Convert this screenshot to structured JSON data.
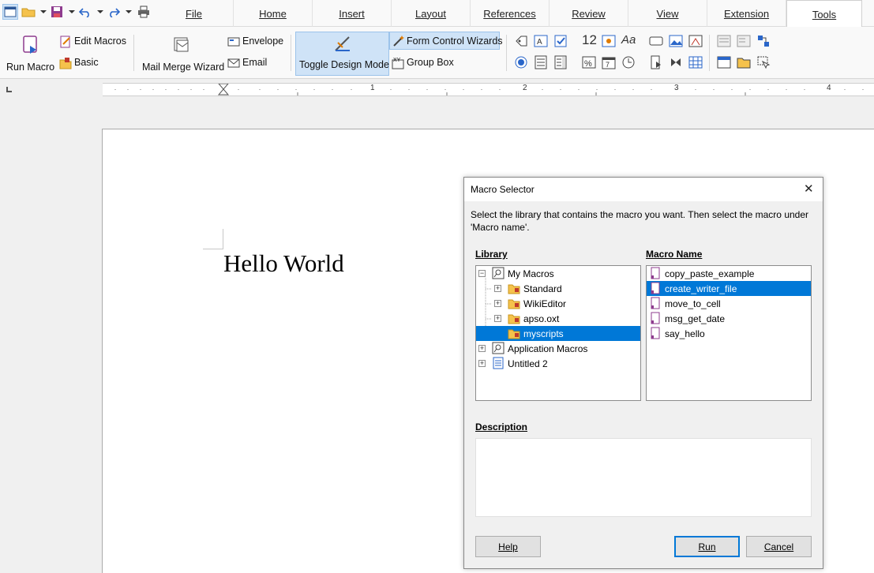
{
  "tabs": [
    "File",
    "Home",
    "Insert",
    "Layout",
    "References",
    "Review",
    "View",
    "Extension",
    "Tools"
  ],
  "active_tab": "Tools",
  "ribbon": {
    "run_macro": "Run Macro",
    "edit_macros": "Edit Macros",
    "basic": "Basic",
    "mail_merge": "Mail Merge Wizard",
    "envelope": "Envelope",
    "email": "Email",
    "toggle_design": "Toggle Design Mode",
    "form_wizards": "Form Control Wizards",
    "group_box": "Group Box",
    "numeric_glyph": "12",
    "format_glyph": "Aa"
  },
  "ruler": {
    "marks": [
      "1",
      "2",
      "3",
      "4"
    ]
  },
  "document": {
    "text": "Hello World"
  },
  "dialog": {
    "title": "Macro Selector",
    "instructions": "Select the library that contains the macro you want. Then select the macro under 'Macro name'.",
    "library_label": "Library",
    "macro_name_label": "Macro Name",
    "library_tree": [
      "My Macros",
      "Standard",
      "WikiEditor",
      "apso.oxt",
      "myscripts",
      "Application Macros",
      "Untitled 2"
    ],
    "selected_library": "myscripts",
    "macros": [
      "copy_paste_example",
      "create_writer_file",
      "move_to_cell",
      "msg_get_date",
      "say_hello"
    ],
    "selected_macro": "create_writer_file",
    "description_label": "Description",
    "description": "",
    "help_button": "Help",
    "run_button": "Run",
    "cancel_button": "Cancel",
    "close_glyph": "✕"
  },
  "colors": {
    "selection": "#0078d7",
    "ribbon_highlight": "#cfe3f7",
    "accent_red": "#c0392b"
  }
}
